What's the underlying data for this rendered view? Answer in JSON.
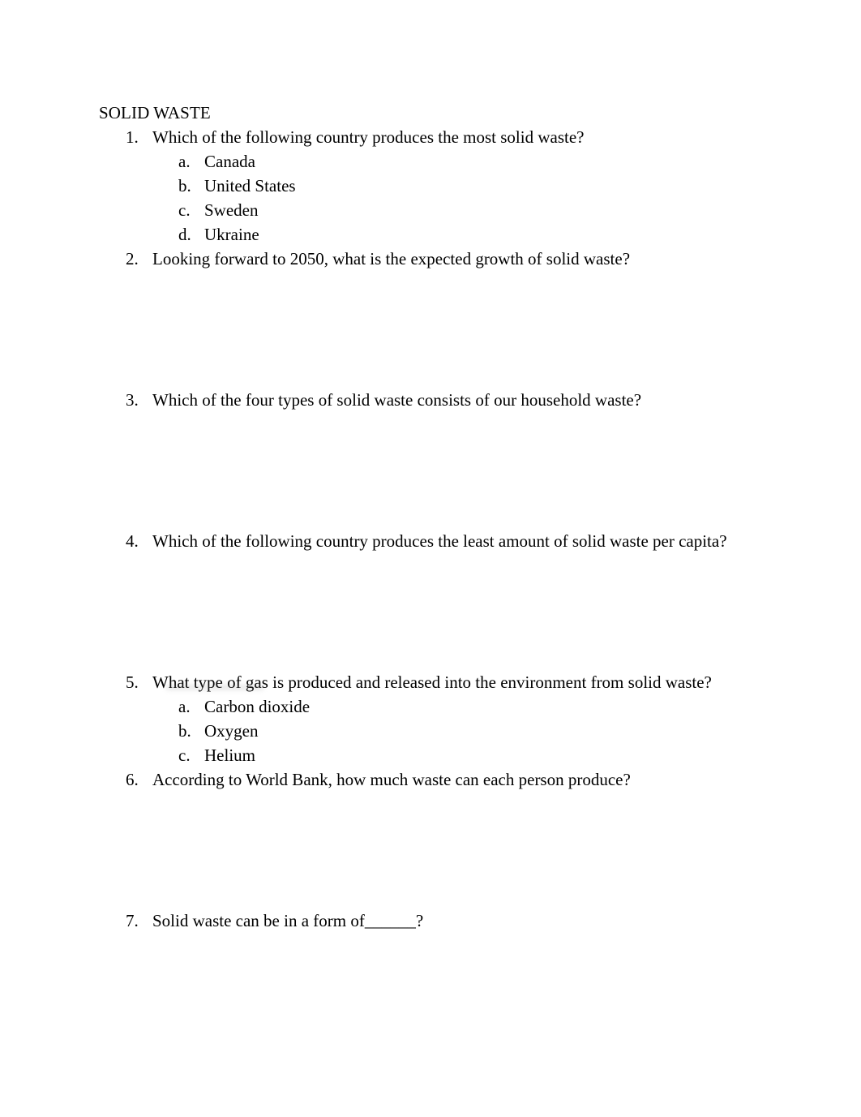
{
  "document": {
    "title": "SOLID WASTE",
    "highlight_color": "#ffff00",
    "text_color": "#000000",
    "page_background": "#ffffff"
  },
  "questions": [
    {
      "number": "1.",
      "text": "Which of the following country produces the most solid waste?",
      "answer_space": 0,
      "options": [
        {
          "letter": "a.",
          "text": "Canada",
          "highlighted": "strong"
        },
        {
          "letter": "b.",
          "text": "United States",
          "highlighted": "none"
        },
        {
          "letter": "c.",
          "text": "Sweden",
          "highlighted": "none"
        },
        {
          "letter": "d.",
          "text": "Ukraine",
          "highlighted": "none"
        }
      ]
    },
    {
      "number": "2.",
      "text": "Looking forward to 2050, what is the expected growth of solid waste?",
      "answer_space": 144,
      "options": []
    },
    {
      "number": "3.",
      "text": "Which of the four types of solid waste consists of our household waste?",
      "answer_space": 144,
      "options": []
    },
    {
      "number": "4.",
      "text": "Which of the following country produces the least amount of solid waste per capita?",
      "answer_space": 144,
      "options": []
    },
    {
      "number": "5.",
      "text": "What type of gas is produced and released into the environment from solid waste?",
      "answer_space": 0,
      "options": [
        {
          "letter": "a.",
          "text": "Carbon dioxide",
          "highlighted": "none"
        },
        {
          "letter": "b.",
          "text": "Oxygen",
          "highlighted": "none"
        },
        {
          "letter": "c.",
          "text": "Helium",
          "highlighted": "faint"
        }
      ]
    },
    {
      "number": "6.",
      "text": "According to World Bank, how much waste can each person produce?",
      "answer_space": 144,
      "options": []
    },
    {
      "number": "7.",
      "text": "Solid waste can be in a form of______?",
      "answer_space": 0,
      "options": []
    }
  ]
}
